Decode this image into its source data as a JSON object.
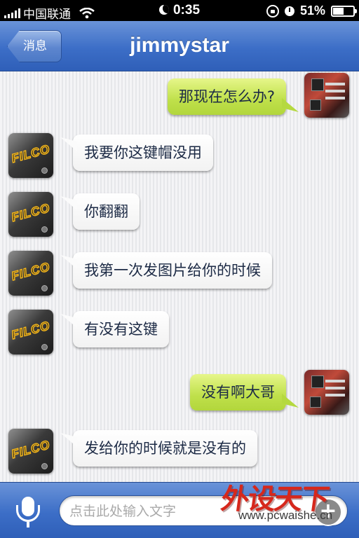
{
  "status_bar": {
    "carrier": "中国联通",
    "time": "0:35",
    "battery_percent": "51%",
    "signal_bars": 5
  },
  "nav": {
    "back_label": "消息",
    "title": "jimmystar"
  },
  "messages": [
    {
      "side": "out",
      "avatar": "motherboard-avatar",
      "text": "那现在怎么办?"
    },
    {
      "side": "in",
      "avatar": "filco-avatar",
      "text": "我要你这键帽没用"
    },
    {
      "side": "in",
      "avatar": "filco-avatar",
      "text": "你翻翻"
    },
    {
      "side": "in",
      "avatar": "filco-avatar",
      "text": "我第一次发图片给你的时候"
    },
    {
      "side": "in",
      "avatar": "filco-avatar",
      "text": "有没有这键"
    },
    {
      "side": "out",
      "avatar": "motherboard-avatar",
      "text": "没有啊大哥"
    },
    {
      "side": "in",
      "avatar": "filco-avatar",
      "text": "发给你的时候就是没有的"
    }
  ],
  "avatar_text": {
    "filco": "FILCO"
  },
  "input_bar": {
    "placeholder": "点击此处输入文字",
    "mic_icon": "microphone-icon",
    "plus_icon": "plus-icon"
  },
  "watermark": {
    "main": "外设天下",
    "url": "www.pcwaishe.cn"
  },
  "colors": {
    "nav_blue": "#3c6ec7",
    "out_bubble": "#bfe04a",
    "in_bubble": "#ffffff",
    "watermark_red": "#d6281c"
  }
}
